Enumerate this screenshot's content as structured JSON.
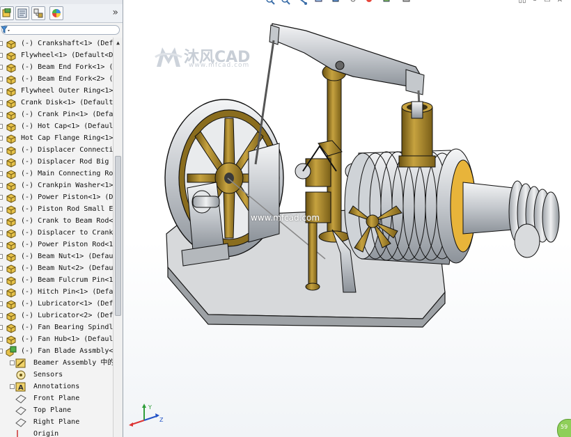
{
  "left_panel": {
    "manager_tabs": [
      {
        "icon": "feature-manager-icon"
      },
      {
        "icon": "property-manager-icon"
      },
      {
        "icon": "configuration-manager-icon"
      },
      {
        "icon": "appearance-manager-icon"
      }
    ],
    "more_glyph": "»",
    "tree_items": [
      {
        "label": "(-) Crankshaft<1> (Defa",
        "icon": "part-icon"
      },
      {
        "label": "Flywheel<1> (Default<D",
        "icon": "part-icon"
      },
      {
        "label": "(-) Beam End Fork<1> (D",
        "icon": "part-icon"
      },
      {
        "label": "(-) Beam End Fork<2> (D",
        "icon": "part-icon"
      },
      {
        "label": "Flywheel Outer Ring<1>",
        "icon": "part-icon"
      },
      {
        "label": "Crank Disk<1> (Default<",
        "icon": "part-icon"
      },
      {
        "label": "(-) Crank Pin<1> (Defau",
        "icon": "part-icon"
      },
      {
        "label": "(-) Hot Cap<1> (Default",
        "icon": "part-icon"
      },
      {
        "label": "Hot Cap Flange Ring<1>",
        "icon": "part-icon"
      },
      {
        "label": "(-) Displacer Connectin",
        "icon": "part-icon"
      },
      {
        "label": "(-) Displacer Rod Big E",
        "icon": "part-icon"
      },
      {
        "label": "(-) Main Connecting Rod",
        "icon": "part-icon"
      },
      {
        "label": "(-) Crankpin Washer<1>",
        "icon": "part-icon"
      },
      {
        "label": "(-) Power Piston<1> (De",
        "icon": "part-icon"
      },
      {
        "label": "(-) Piston Rod Small En",
        "icon": "part-icon"
      },
      {
        "label": "(-) Crank to Beam Rod<1",
        "icon": "part-icon"
      },
      {
        "label": "(-) Displacer to Crank",
        "icon": "part-icon"
      },
      {
        "label": "(-) Power Piston Rod<1>",
        "icon": "part-icon"
      },
      {
        "label": "(-) Beam Nut<1> (Defaul",
        "icon": "part-icon"
      },
      {
        "label": "(-) Beam Nut<2> (Defaul",
        "icon": "part-icon"
      },
      {
        "label": "(-) Beam Fulcrum Pin<1>",
        "icon": "part-icon"
      },
      {
        "label": "(-) Hitch Pin<1> (Defau",
        "icon": "part-icon"
      },
      {
        "label": "(-) Lubricator<1> (Defa",
        "icon": "part-icon"
      },
      {
        "label": "(-) Lubricator<2> (Defa",
        "icon": "part-icon"
      },
      {
        "label": "(-) Fan Bearing Spindle",
        "icon": "part-icon"
      },
      {
        "label": "(-) Fan Hub<1> (Default",
        "icon": "part-icon"
      },
      {
        "label": "(-) Fan Blade Assmbly<1",
        "icon": "subassembly-icon"
      },
      {
        "label": "Beamer Assembly 中的",
        "icon": "mates-icon"
      },
      {
        "label": "Sensors",
        "icon": "sensors-icon"
      },
      {
        "label": "Annotations",
        "icon": "annotations-icon"
      },
      {
        "label": "Front Plane",
        "icon": "plane-icon"
      },
      {
        "label": "Top Plane",
        "icon": "plane-icon"
      },
      {
        "label": "Right Plane",
        "icon": "plane-icon"
      },
      {
        "label": "Origin",
        "icon": "origin-icon"
      }
    ]
  },
  "viewport": {
    "watermark_brand": "沐风CAD",
    "watermark_url": "www.mfcad.com",
    "center_watermark": "www.mfcad.com",
    "status_value": "59",
    "heads_up_icons": [
      "zoom-to-fit-icon",
      "zoom-area-icon",
      "previous-view-icon",
      "section-view-icon",
      "view-orientation-icon",
      "display-style-icon",
      "hide-show-icon",
      "appearance-icon",
      "scene-icon",
      "view-settings-icon"
    ],
    "colors": {
      "brass": "#a8862a",
      "steel": "#c9cdd2",
      "base": "#d8dadc",
      "outline": "#1a1a1a"
    }
  }
}
